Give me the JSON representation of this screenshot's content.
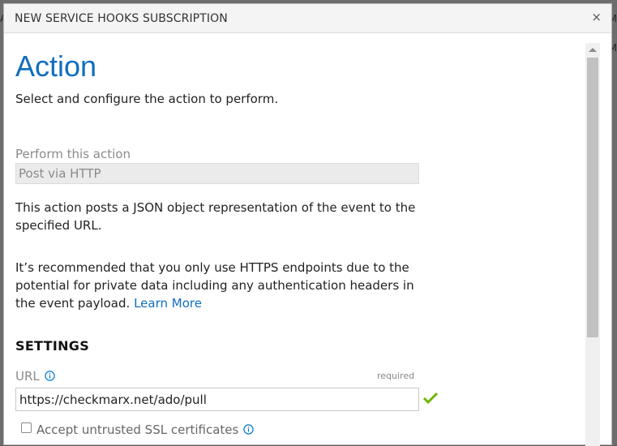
{
  "background": {
    "left_glyph": "A",
    "right_glyph_1": "M",
    "right_glyph_2": "M"
  },
  "dialog": {
    "title": "NEW SERVICE HOOKS SUBSCRIPTION",
    "close_symbol": "×"
  },
  "page": {
    "heading": "Action",
    "subtitle": "Select and configure the action to perform."
  },
  "perform_action": {
    "label": "Perform this action",
    "value": "Post via HTTP"
  },
  "description": {
    "paragraph1": "This action posts a JSON object representation of the event to the specified URL.",
    "paragraph2_text": "It’s recommended that you only use HTTPS endpoints due to the potential for private data including any authentication headers in the event payload. ",
    "learn_more": "Learn More"
  },
  "settings": {
    "heading": "SETTINGS",
    "url_label": "URL",
    "url_required": "required",
    "url_value": "https://checkmarx.net/ado/pull",
    "ssl_checkbox_label": "Accept untrusted SSL certificates",
    "ssl_checked": false
  },
  "colors": {
    "accent": "#106ebe",
    "success": "#6bb700",
    "info_icon": "#0078d4"
  },
  "icons": {
    "url_info": "info-icon",
    "ssl_info": "info-icon",
    "url_valid": "checkmark-icon",
    "close": "close-icon"
  }
}
